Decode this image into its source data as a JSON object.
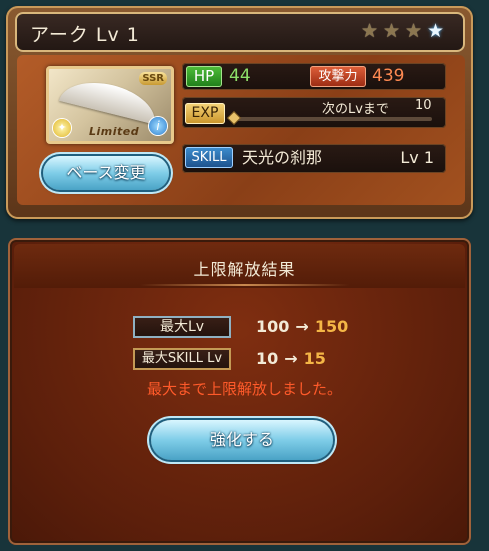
{
  "card": {
    "name_level": "アーク Lv 1",
    "stars": [
      "rank",
      "rank",
      "rank",
      "unlocked"
    ],
    "weapon": {
      "rarity": "SSR",
      "limited_label": "Limited",
      "element_icon": "light-element-icon",
      "info_icon": "info-icon"
    },
    "base_change_button": "ベース変更",
    "stats": {
      "hp_label": "HP",
      "hp_value": "44",
      "atk_label": "攻撃力",
      "atk_value": "439",
      "exp_label": "EXP",
      "exp_next_label": "次のLvまで",
      "exp_next_value": "10",
      "exp_progress": 0.0,
      "skill_label": "SKILL",
      "skill_name": "天光の刹那",
      "skill_level": "Lv 1"
    }
  },
  "result": {
    "title": "上限解放結果",
    "max_lv_label": "最大Lv",
    "max_lv_before": "100",
    "max_lv_after": "150",
    "max_skill_label": "最大SKILL Lv",
    "max_skill_before": "10",
    "max_skill_after": "15",
    "arrow": "→",
    "message": "最大まで上限解放しました。",
    "enhance_button": "強化する"
  }
}
